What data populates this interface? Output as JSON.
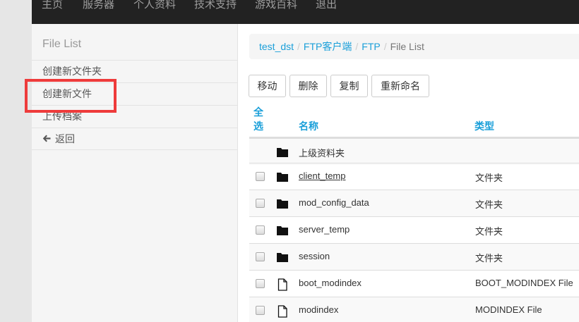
{
  "nav": {
    "items": [
      "主页",
      "服务器",
      "个人资料",
      "技术支持",
      "游戏百科",
      "退出"
    ]
  },
  "sidebar": {
    "header": "File List",
    "items": [
      {
        "label": "创建新文件夹"
      },
      {
        "label": "创建新文件"
      },
      {
        "label": "上传档案"
      },
      {
        "label": "返回",
        "icon": "arrow-left-icon"
      }
    ]
  },
  "breadcrumb": {
    "links": [
      "test_dst",
      "FTP客户端",
      "FTP"
    ],
    "separator": "/",
    "active": "File List"
  },
  "toolbar": {
    "buttons": [
      "移动",
      "删除",
      "复制",
      "重新命名"
    ]
  },
  "table": {
    "headers": {
      "select_all": "全选",
      "select_all_line1": "全",
      "select_all_line2": "选",
      "name": "名称",
      "type": "类型"
    },
    "parent_row": {
      "name": "上级资料夹",
      "icon": "folder-icon"
    },
    "rows": [
      {
        "name": "client_temp",
        "type": "文件夹",
        "icon": "folder-icon"
      },
      {
        "name": "mod_config_data",
        "type": "文件夹",
        "icon": "folder-icon"
      },
      {
        "name": "server_temp",
        "type": "文件夹",
        "icon": "folder-icon"
      },
      {
        "name": "session",
        "type": "文件夹",
        "icon": "folder-icon"
      },
      {
        "name": "boot_modindex",
        "type": "BOOT_MODINDEX File",
        "icon": "file-icon"
      },
      {
        "name": "modindex",
        "type": "MODINDEX File",
        "icon": "file-icon"
      }
    ]
  },
  "colors": {
    "navbar_bg": "#222222",
    "link": "#1a9fd9",
    "highlight": "#ee3b3b"
  }
}
